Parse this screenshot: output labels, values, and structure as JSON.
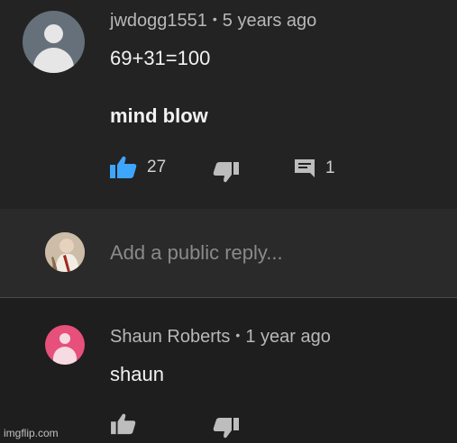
{
  "comment": {
    "author": "jwdogg1551",
    "separator": "•",
    "age": "5 years ago",
    "line1": "69+31=100",
    "line2": "mind blow",
    "like_count": "27",
    "reply_count": "1"
  },
  "reply_box": {
    "placeholder": "Add a public reply..."
  },
  "reply": {
    "author": "Shaun Roberts",
    "separator": "•",
    "age": "1 year ago",
    "text": "shaun"
  },
  "watermark": "imgflip.com",
  "colors": {
    "like_active": "#3ea6ff",
    "icon_gray": "#bdbdbd",
    "reply_avatar": "#e6507a"
  },
  "icons": {
    "avatar": "default-avatar-icon",
    "like": "thumbs-up-icon",
    "dislike": "thumbs-down-icon",
    "reply": "comment-icon"
  }
}
